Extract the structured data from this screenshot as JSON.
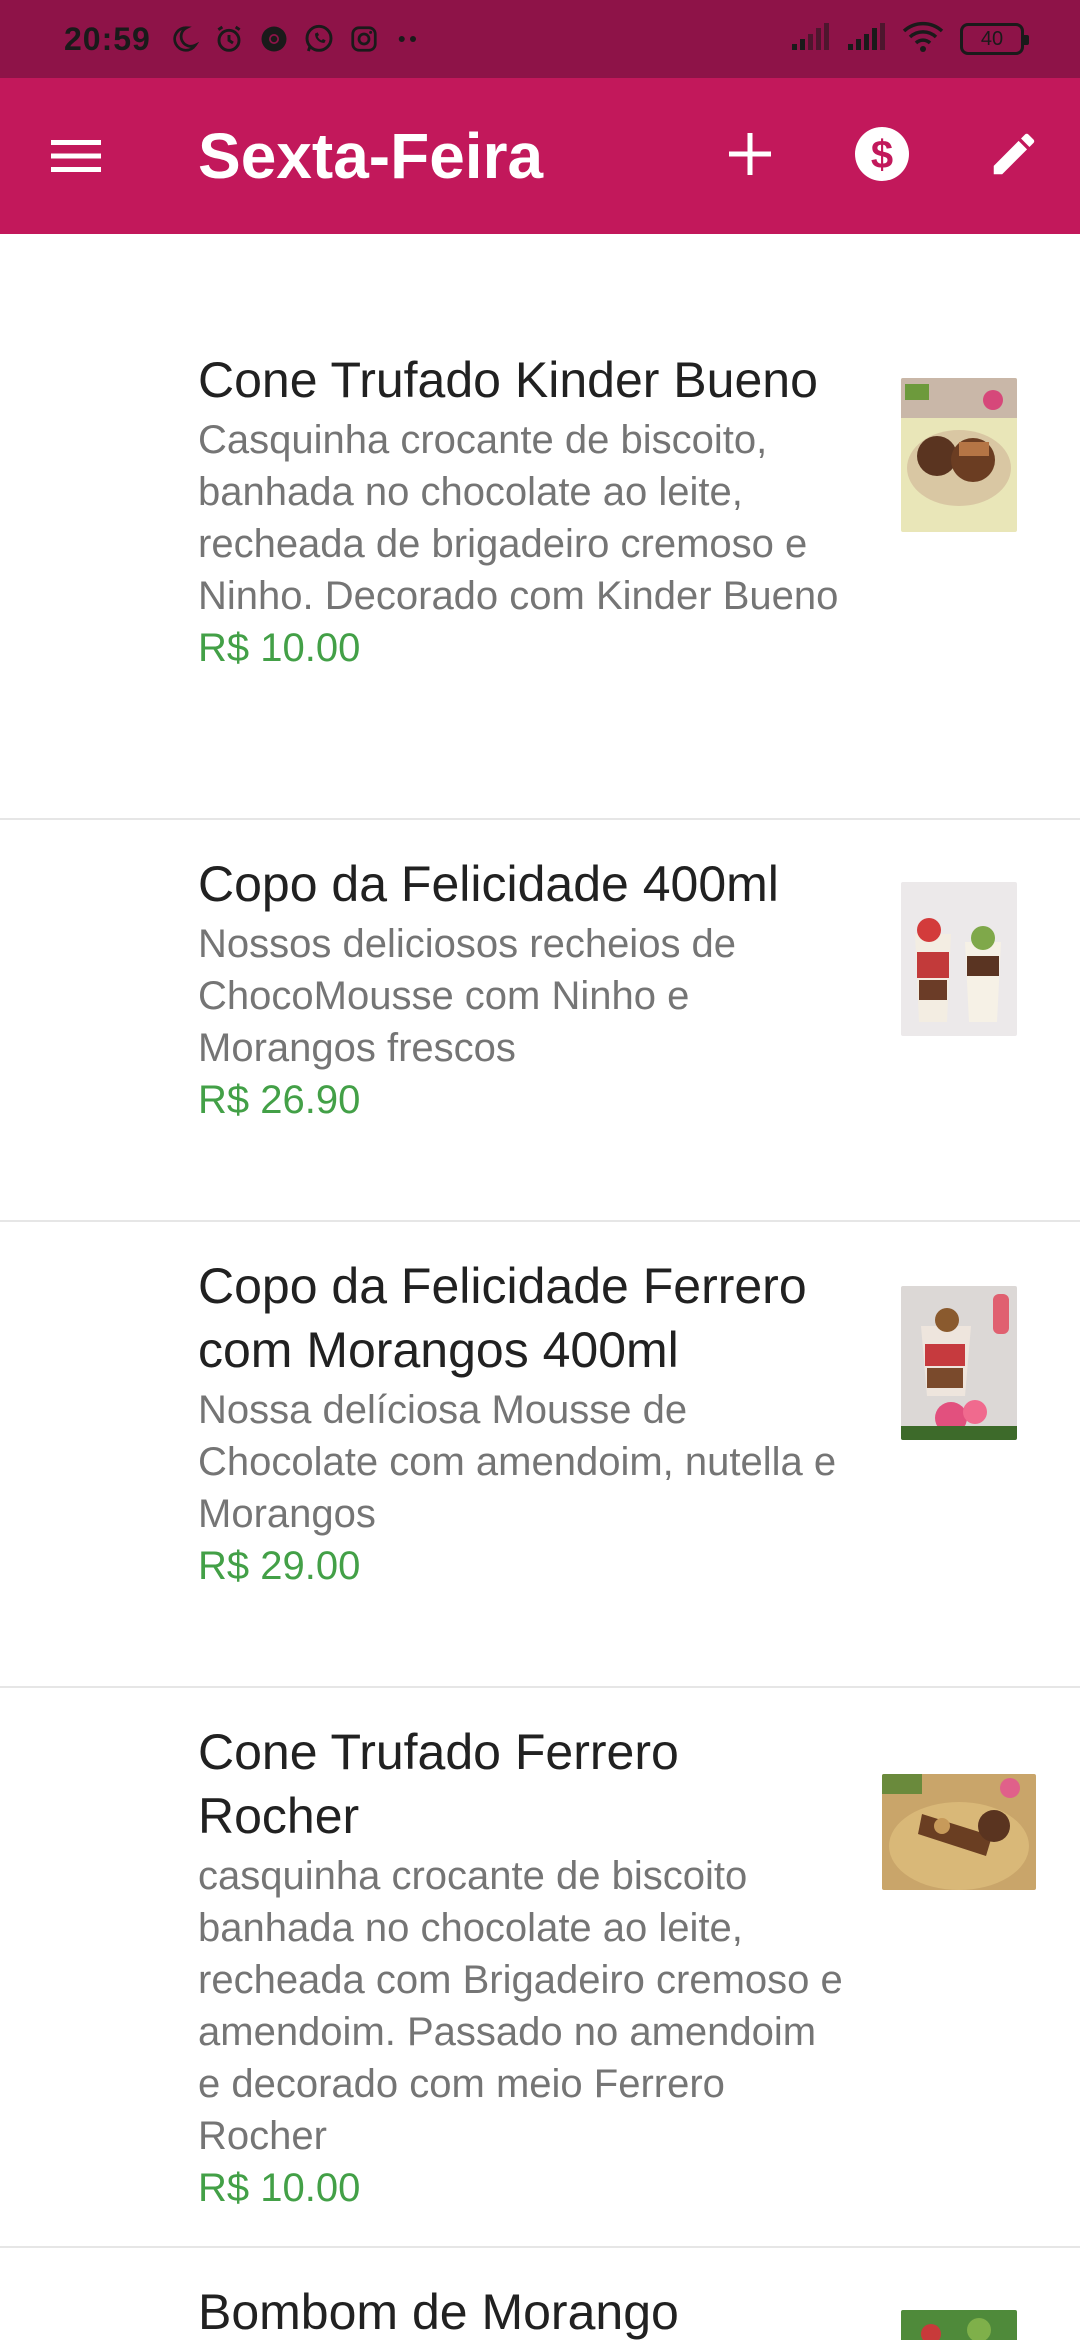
{
  "status_bar": {
    "time": "20:59",
    "battery": "40",
    "left_icons": [
      "moon-icon",
      "alarm-icon",
      "chrome-icon",
      "whatsapp-icon",
      "instagram-icon",
      "more-dots-icon"
    ],
    "right_icons": [
      "signal-icon",
      "signal-icon",
      "wifi-icon",
      "battery-icon"
    ]
  },
  "app_bar": {
    "title": "Sexta-Feira",
    "background": "#c2185b",
    "menu_icon": "menu-icon",
    "add_icon": "plus-icon",
    "price_icon": "dollar-circle-icon",
    "edit_icon": "pencil-icon"
  },
  "products": [
    {
      "name": "Cone Trufado Kinder Bueno",
      "description": "Casquinha crocante de biscoito, banhada no chocolate ao leite, recheada de brigadeiro cremoso e Ninho. Decorado com Kinder Bueno",
      "price": "R$ 10.00"
    },
    {
      "name": "Copo da Felicidade 400ml",
      "description": "Nossos deliciosos recheios de ChocoMousse com Ninho e Morangos frescos",
      "price": "R$ 26.90"
    },
    {
      "name": "Copo da Felicidade Ferrero com Morangos 400ml",
      "description": "Nossa delíciosa Mousse de Chocolate com amendoim, nutella e Morangos",
      "price": "R$ 29.00"
    },
    {
      "name": "Cone Trufado Ferrero Rocher",
      "description": "casquinha crocante de biscoito banhada no chocolate ao leite, recheada com Brigadeiro cremoso e amendoim. Passado no amendoim e decorado com meio Ferrero Rocher",
      "price": "R$ 10.00"
    },
    {
      "name": "Bombom de Morango",
      "description": "",
      "price": ""
    }
  ],
  "colors": {
    "status_bar": "#8e1348",
    "app_bar": "#c2185b",
    "price": "#43a047",
    "name": "#212121",
    "description": "#757575"
  }
}
